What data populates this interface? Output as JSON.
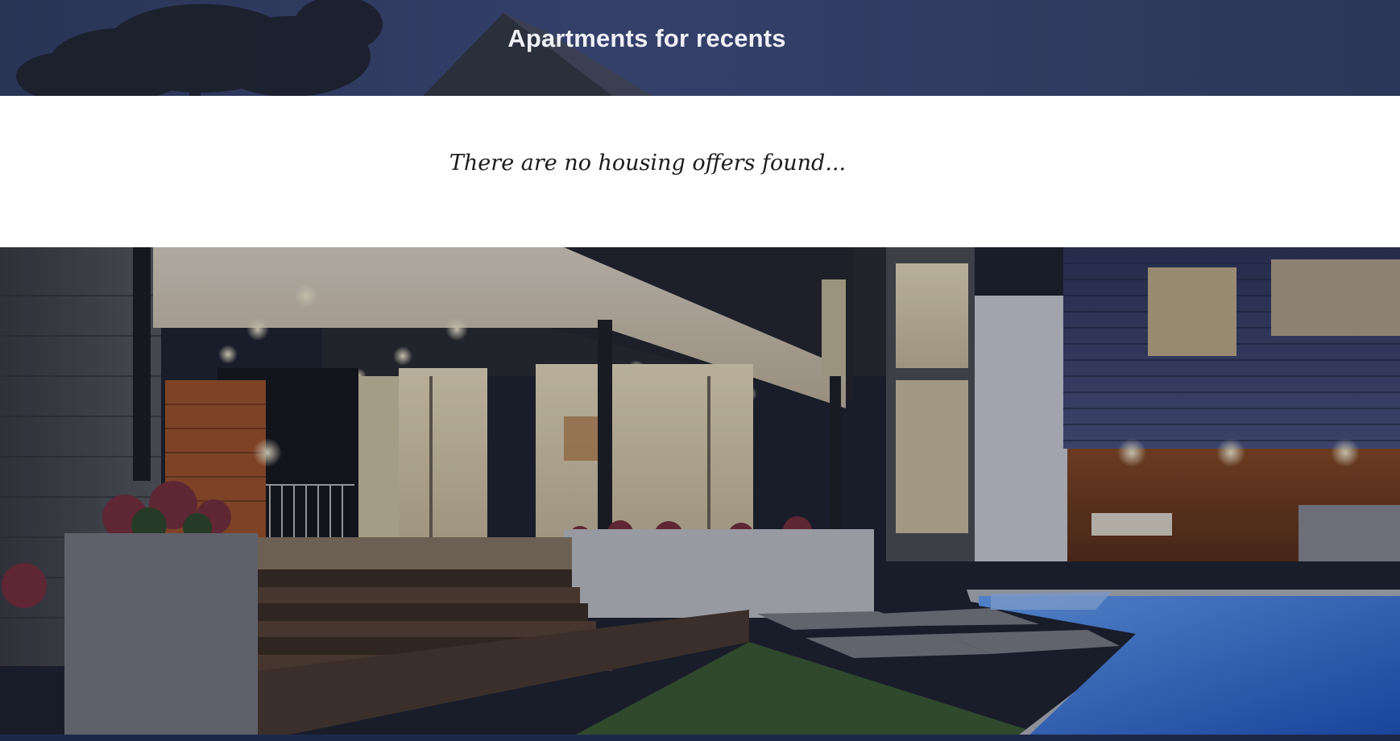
{
  "header": {
    "title": "Apartments for recents"
  },
  "message": {
    "empty_text": "There are no housing offers found..."
  },
  "colors": {
    "header_bg": "#2f3a60",
    "panel_bg": "#ffffff",
    "title_text": "#eef0f6",
    "message_text": "#1c1c1c"
  }
}
